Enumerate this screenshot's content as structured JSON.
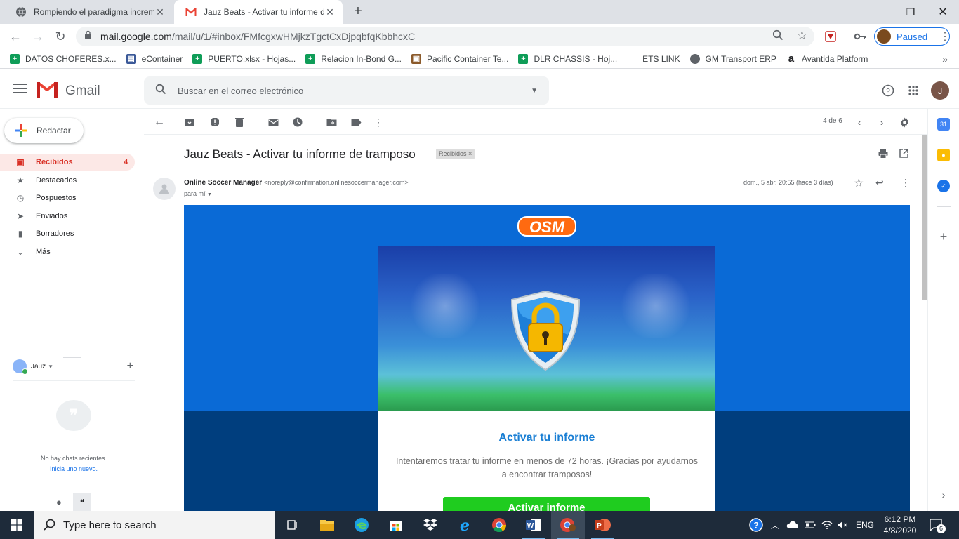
{
  "browser": {
    "tabs": [
      {
        "title": "Rompiendo el paradigma increm",
        "active": false
      },
      {
        "title": "Jauz Beats - Activar tu informe de",
        "active": true
      }
    ],
    "url_host": "mail.google.com",
    "url_path": "/mail/u/1/#inbox/FMfcgxwHMjkzTgctCxDjpqbfqKbbhcxC",
    "profile_status": "Paused",
    "bookmarks": [
      {
        "label": "DATOS CHOFERES.x...",
        "icon": "sheets-icon"
      },
      {
        "label": "eContainer",
        "icon": "container-icon"
      },
      {
        "label": "PUERTO.xlsx - Hojas...",
        "icon": "sheets-icon"
      },
      {
        "label": "Relacion In-Bond G...",
        "icon": "sheets-icon"
      },
      {
        "label": "Pacific Container Te...",
        "icon": "folder-icon"
      },
      {
        "label": "DLR CHASSIS - Hoj...",
        "icon": "sheets-icon"
      },
      {
        "label": "ETS LINK",
        "icon": "none"
      },
      {
        "label": "GM Transport ERP",
        "icon": "globe-icon"
      },
      {
        "label": "Avantida Platform",
        "icon": "amazon-icon"
      }
    ]
  },
  "gmail": {
    "brand": "Gmail",
    "search_placeholder": "Buscar en el correo electrónico",
    "account_initial": "J",
    "compose_label": "Redactar",
    "nav": [
      {
        "label": "Recibidos",
        "count": "4",
        "icon": "inbox-icon",
        "active": true
      },
      {
        "label": "Destacados",
        "count": "",
        "icon": "star-icon",
        "active": false
      },
      {
        "label": "Pospuestos",
        "count": "",
        "icon": "clock-icon",
        "active": false
      },
      {
        "label": "Enviados",
        "count": "",
        "icon": "send-icon",
        "active": false
      },
      {
        "label": "Borradores",
        "count": "",
        "icon": "draft-icon",
        "active": false
      },
      {
        "label": "Más",
        "count": "",
        "icon": "chevron-down-icon",
        "active": false
      }
    ],
    "chat": {
      "user": "Jauz",
      "no_chats": "No hay chats recientes.",
      "start_new": "Inicia uno nuevo."
    },
    "pager": "4 de 6",
    "message": {
      "subject": "Jauz Beats - Activar tu informe de tramposo",
      "label": "Recibidos",
      "sender_name": "Online Soccer Manager",
      "sender_email": "<noreply@confirmation.onlinesoccermanager.com>",
      "to": "para mí",
      "date": "dom., 5 abr. 20:55 (hace 3 días)"
    },
    "email_body": {
      "logo_text": "OSM",
      "heading": "Activar tu informe",
      "text": "Intentaremos tratar tu informe en menos de 72 horas. ¡Gracias por ayudarnos a encontrar tramposos!",
      "button": "Activar informe"
    }
  },
  "taskbar": {
    "search_placeholder": "Type here to search",
    "language": "ENG",
    "time": "6:12 PM",
    "date": "4/8/2020",
    "notifications": "6"
  }
}
